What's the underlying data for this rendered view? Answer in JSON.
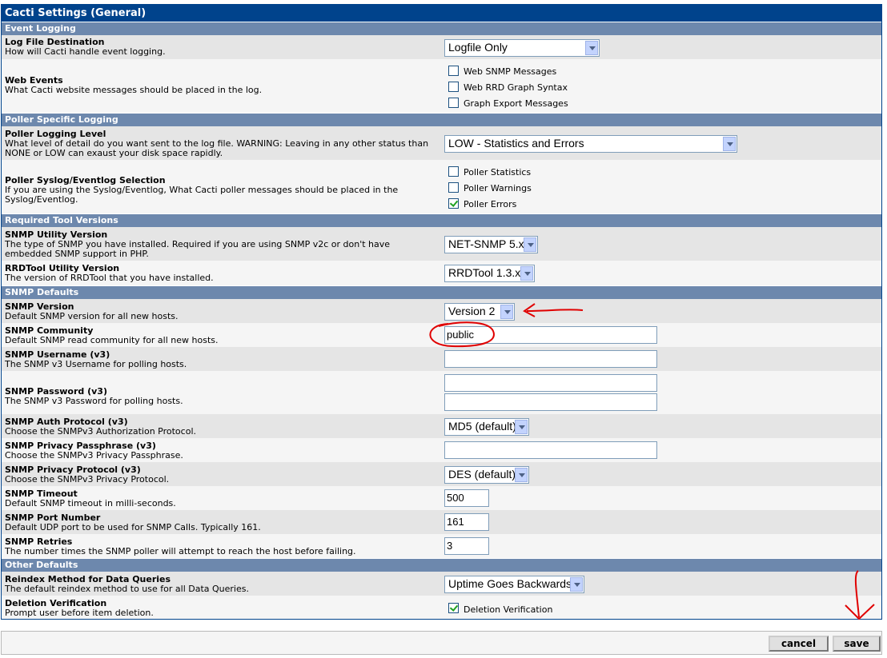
{
  "title": "Cacti Settings (General)",
  "sections": {
    "event_logging": "Event Logging",
    "poller_logging": "Poller Specific Logging",
    "tool_versions": "Required Tool Versions",
    "snmp_defaults": "SNMP Defaults",
    "other_defaults": "Other Defaults"
  },
  "log_file": {
    "label": "Log File Destination",
    "desc": "How will Cacti handle event logging.",
    "value": "Logfile Only"
  },
  "web_events": {
    "label": "Web Events",
    "desc": "What Cacti website messages should be placed in the log.",
    "options": [
      {
        "label": "Web SNMP Messages",
        "checked": false
      },
      {
        "label": "Web RRD Graph Syntax",
        "checked": false
      },
      {
        "label": "Graph Export Messages",
        "checked": false
      }
    ]
  },
  "poller_level": {
    "label": "Poller Logging Level",
    "desc1": "What level of detail do you want sent to the log file. WARNING: Leaving in any other status than",
    "desc2": "NONE or LOW can exaust your disk space rapidly.",
    "value": "LOW - Statistics and Errors"
  },
  "poller_syslog": {
    "label": "Poller Syslog/Eventlog Selection",
    "desc1": "If you are using the Syslog/Eventlog, What Cacti poller messages should be placed in the",
    "desc2": "Syslog/Eventlog.",
    "options": [
      {
        "label": "Poller Statistics",
        "checked": false
      },
      {
        "label": "Poller Warnings",
        "checked": false
      },
      {
        "label": "Poller Errors",
        "checked": true
      }
    ]
  },
  "snmp_utility": {
    "label": "SNMP Utility Version",
    "desc1": "The type of SNMP you have installed. Required if you are using SNMP v2c or don't have",
    "desc2": "embedded SNMP support in PHP.",
    "value": "NET-SNMP 5.x"
  },
  "rrdtool": {
    "label": "RRDTool Utility Version",
    "desc": "The version of RRDTool that you have installed.",
    "value": "RRDTool 1.3.x"
  },
  "snmp_version": {
    "label": "SNMP Version",
    "desc": "Default SNMP version for all new hosts.",
    "value": "Version 2"
  },
  "snmp_community": {
    "label": "SNMP Community",
    "desc": "Default SNMP read community for all new hosts.",
    "value": "public"
  },
  "snmp_username": {
    "label": "SNMP Username (v3)",
    "desc": "The SNMP v3 Username for polling hosts.",
    "value": ""
  },
  "snmp_password": {
    "label": "SNMP Password (v3)",
    "desc": "The SNMP v3 Password for polling hosts.",
    "value": "",
    "confirm": ""
  },
  "snmp_auth": {
    "label": "SNMP Auth Protocol (v3)",
    "desc": "Choose the SNMPv3 Authorization Protocol.",
    "value": "MD5 (default)"
  },
  "snmp_priv_pass": {
    "label": "SNMP Privacy Passphrase (v3)",
    "desc": "Choose the SNMPv3 Privacy Passphrase.",
    "value": ""
  },
  "snmp_priv_proto": {
    "label": "SNMP Privacy Protocol (v3)",
    "desc": "Choose the SNMPv3 Privacy Protocol.",
    "value": "DES (default)"
  },
  "snmp_timeout": {
    "label": "SNMP Timeout",
    "desc": "Default SNMP timeout in milli-seconds.",
    "value": "500"
  },
  "snmp_port": {
    "label": "SNMP Port Number",
    "desc": "Default UDP port to be used for SNMP Calls. Typically 161.",
    "value": "161"
  },
  "snmp_retries": {
    "label": "SNMP Retries",
    "desc": "The number times the SNMP poller will attempt to reach the host before failing.",
    "value": "3"
  },
  "reindex": {
    "label": "Reindex Method for Data Queries",
    "desc": "The default reindex method to use for all Data Queries.",
    "value": "Uptime Goes Backwards"
  },
  "deletion": {
    "label": "Deletion Verification",
    "desc": "Prompt user before item deletion.",
    "option": "Deletion Verification",
    "checked": true
  },
  "buttons": {
    "cancel": "cancel",
    "save": "save"
  },
  "colors": {
    "header": "#00438C",
    "section": "#6D88AD",
    "row_alt": "#E5E5E5",
    "row": "#F5F5F5",
    "annotation": "#E00000"
  }
}
